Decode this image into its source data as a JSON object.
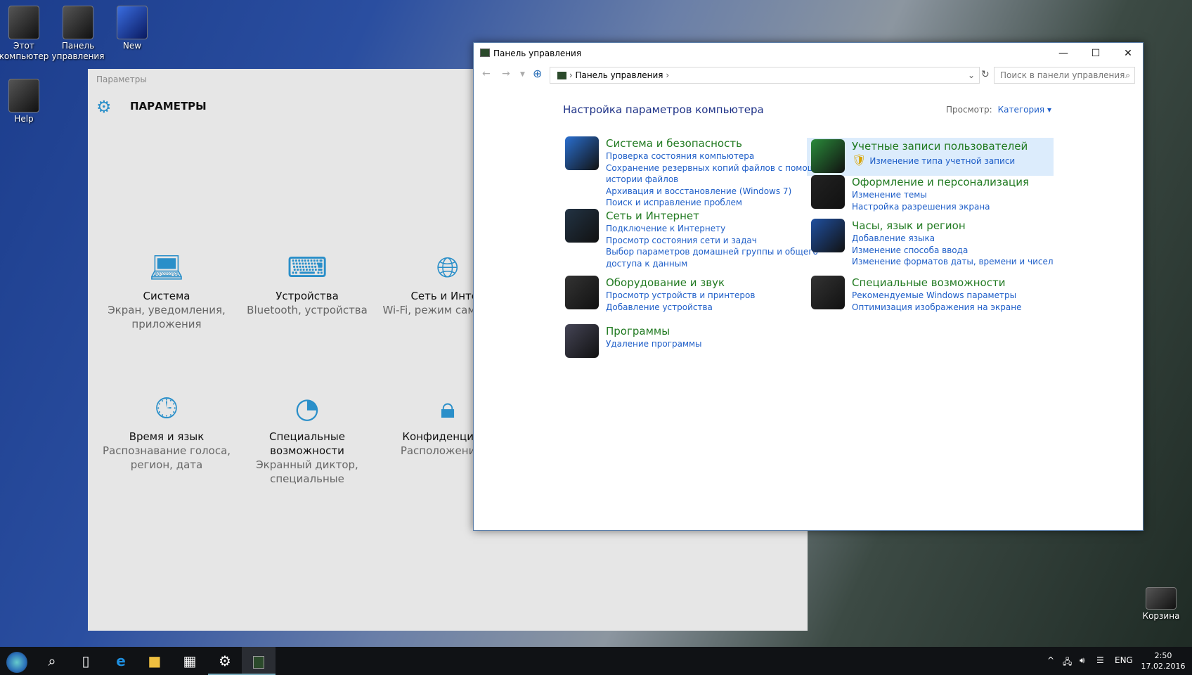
{
  "desktop": {
    "icons": [
      {
        "label": "Этот компьютер"
      },
      {
        "label": "Панель управления"
      },
      {
        "label": "New"
      },
      {
        "label": "Help"
      },
      {
        "label": "Корзина"
      }
    ]
  },
  "settings": {
    "window_title": "Параметры",
    "header": "ПАРАМЕТРЫ",
    "tiles": [
      {
        "title": "Система",
        "subtitle": "Экран, уведомления, приложения",
        "icon": "laptop-icon"
      },
      {
        "title": "Устройства",
        "subtitle": "Bluetooth, устройства",
        "icon": "devices-icon"
      },
      {
        "title": "Сеть и Интер",
        "subtitle": "Wi-Fi, режим самолете\"",
        "icon": "globe-icon"
      },
      {
        "title": "Время и язык",
        "subtitle": "Распознавание голоса, регион, дата",
        "icon": "time-language-icon"
      },
      {
        "title": "Специальные возможности",
        "subtitle": "Экранный диктор, специальные",
        "icon": "ease-of-access-icon"
      },
      {
        "title": "Конфиденциаль",
        "subtitle": "Расположение, к",
        "icon": "lock-icon"
      }
    ]
  },
  "control_panel": {
    "title": "Панель управления",
    "breadcrumb": "Панель управления",
    "search_placeholder": "Поиск в панели управления",
    "heading": "Настройка параметров компьютера",
    "view_label": "Просмотр:",
    "view_value": "Категория",
    "left": [
      {
        "title": "Система и безопасность",
        "links": [
          "Проверка состояния компьютера",
          "Сохранение резервных копий файлов с помощью истории файлов",
          "Архивация и восстановление (Windows 7)",
          "Поиск и исправление проблем"
        ]
      },
      {
        "title": "Сеть и Интернет",
        "links": [
          "Подключение к Интернету",
          "Просмотр состояния сети и задач",
          "Выбор параметров домашней группы и общего доступа к данным"
        ]
      },
      {
        "title": "Оборудование и звук",
        "links": [
          "Просмотр устройств и принтеров",
          "Добавление устройства"
        ]
      },
      {
        "title": "Программы",
        "links": [
          "Удаление программы"
        ]
      }
    ],
    "right": [
      {
        "title": "Учетные записи пользователей",
        "links": [
          "Изменение типа учетной записи"
        ]
      },
      {
        "title": "Оформление и персонализация",
        "links": [
          "Изменение темы",
          "Настройка разрешения экрана"
        ]
      },
      {
        "title": "Часы, язык и регион",
        "links": [
          "Добавление языка",
          "Изменение способа ввода",
          "Изменение форматов даты, времени и чисел"
        ]
      },
      {
        "title": "Специальные возможности",
        "links": [
          "Рекомендуемые Windows параметры",
          "Оптимизация изображения на экране"
        ]
      }
    ]
  },
  "taskbar": {
    "language": "ENG",
    "time": "2:50",
    "date": "17.02.2016"
  },
  "colors": {
    "accent": "#2a8fc9",
    "link": "#1e5ec8",
    "category": "#217a21"
  }
}
